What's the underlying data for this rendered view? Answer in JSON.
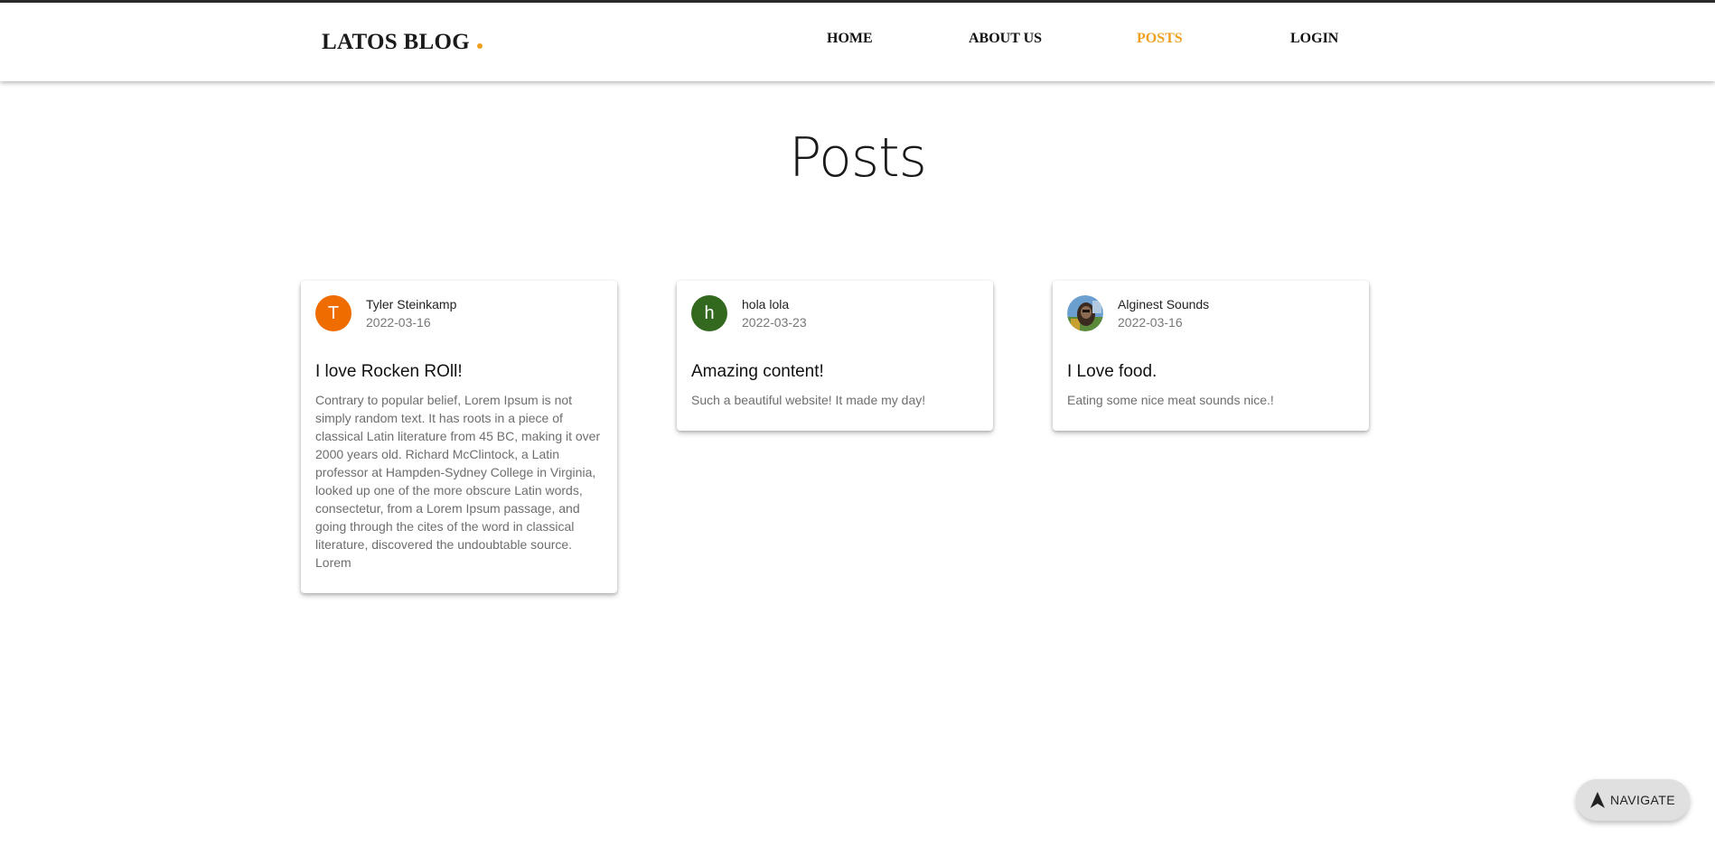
{
  "header": {
    "logo": "LATOS BLOG",
    "nav": [
      {
        "label": "HOME",
        "active": false
      },
      {
        "label": "ABOUT US",
        "active": false
      },
      {
        "label": "POSTS",
        "active": true
      },
      {
        "label": "LOGIN",
        "active": false
      }
    ],
    "accent_color": "#f0a020"
  },
  "page": {
    "title": "Posts"
  },
  "posts": [
    {
      "avatar_letter": "T",
      "avatar_color": "#ef6c00",
      "author": "Tyler Steinkamp",
      "date": "2022-03-16",
      "title": "I love Rocken ROll!",
      "body": "Contrary to popular belief, Lorem Ipsum is not simply random text. It has roots in a piece of classical Latin literature from 45 BC, making it over 2000 years old. Richard McClintock, a Latin professor at Hampden-Sydney College in Virginia, looked up one of the more obscure Latin words, consectetur, from a Lorem Ipsum passage, and going through the cites of the word in classical literature, discovered the undoubtable source. Lorem"
    },
    {
      "avatar_letter": "h",
      "avatar_color": "#33691e",
      "author": "hola lola",
      "date": "2022-03-23",
      "title": "Amazing content!",
      "body": "Such a beautiful website! It made my day!"
    },
    {
      "avatar_letter": "",
      "avatar_color": "#4a6b3a",
      "author": "Alginest Sounds",
      "date": "2022-03-16",
      "title": "I Love food.",
      "body": "Eating some nice meat sounds nice.!"
    }
  ],
  "fab": {
    "label": "NAVIGATE",
    "icon": "navigation-arrow-icon"
  }
}
